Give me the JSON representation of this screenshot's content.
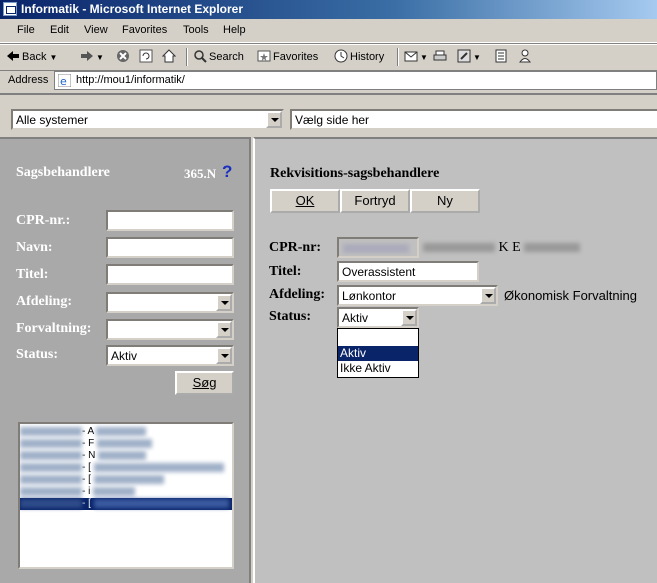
{
  "window": {
    "title": "Informatik  - Microsoft Internet Explorer"
  },
  "menu": [
    "File",
    "Edit",
    "View",
    "Favorites",
    "Tools",
    "Help"
  ],
  "toolbar": {
    "back": "Back",
    "search": "Search",
    "favorites": "Favorites",
    "history": "History"
  },
  "address": {
    "label": "Address",
    "url": "http://mou1/informatik/"
  },
  "topframe": {
    "system_select": "Alle systemer",
    "page_select": "Vælg side her"
  },
  "left": {
    "title": "Sagsbehandlere",
    "code": "365.N",
    "help": "?",
    "labels": {
      "cpr": "CPR-nr.:",
      "name": "Navn:",
      "title": "Titel:",
      "department": "Afdeling:",
      "administration": "Forvaltning:",
      "status": "Status:"
    },
    "status_value": "Aktiv",
    "search_button": "Søg",
    "list_fragments": [
      "- A",
      "- F",
      "- N",
      "- [",
      "- [",
      "- i",
      "- ["
    ]
  },
  "right": {
    "title": "Rekvisitions-sagsbehandlere",
    "buttons": {
      "ok": "OK",
      "cancel": "Fortryd",
      "new": "Ny"
    },
    "labels": {
      "cpr": "CPR-nr:",
      "title": "Titel:",
      "department": "Afdeling:",
      "status": "Status:"
    },
    "cpr_name_visible": "K E",
    "title_value": "Overassistent",
    "department_value": "Lønkontor",
    "administration_text": "Økonomisk Forvaltning",
    "status_value": "Aktiv",
    "status_options": [
      "",
      "Aktiv",
      "Ikke Aktiv"
    ],
    "status_selected": "Aktiv"
  }
}
